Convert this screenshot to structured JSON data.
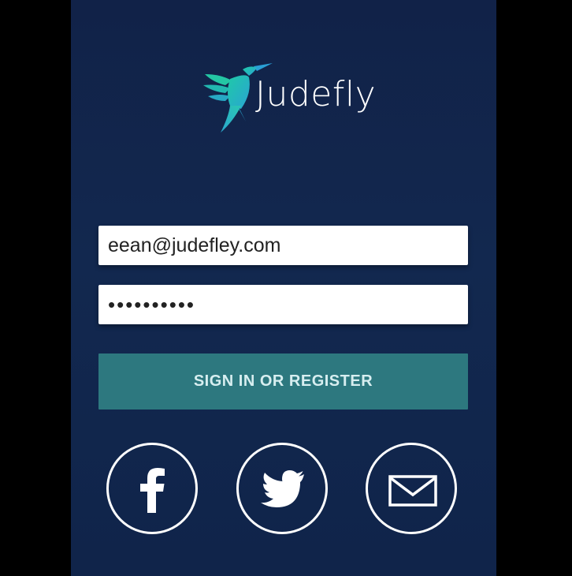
{
  "app": {
    "brand_name": "Judefly"
  },
  "login": {
    "email_value": "eean@judefley.com",
    "password_value": "••••••••••",
    "submit_label": "SIGN IN OR REGISTER"
  },
  "social": {
    "buttons": [
      {
        "icon": "facebook-icon"
      },
      {
        "icon": "twitter-icon"
      },
      {
        "icon": "envelope-icon"
      }
    ]
  },
  "colors": {
    "background": "#12284f",
    "button_teal": "#2d787f",
    "logo_gradient_start": "#2fb6c4",
    "logo_gradient_end": "#3fd0a6"
  }
}
